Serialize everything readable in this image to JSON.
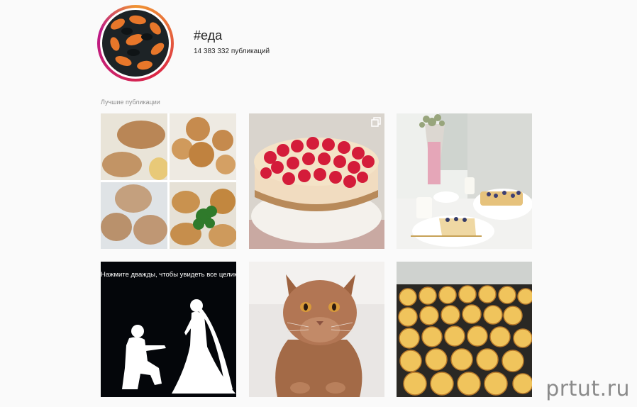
{
  "header": {
    "hashtag": "#еда",
    "post_count": "14 383 332 публикаций",
    "avatar_icon": "food-collage-avatar"
  },
  "top_posts": {
    "section_label": "Лучшие публикации",
    "tiles": [
      {
        "name": "cutlets-collage",
        "kind": "photo"
      },
      {
        "name": "raspberry-cheesecake",
        "kind": "photo",
        "badge_icon": "multi-photo-icon"
      },
      {
        "name": "breakfast-table",
        "kind": "photo"
      },
      {
        "name": "proposal-silhouette",
        "kind": "photo",
        "caption": "Нажмите дважды, чтобы увидеть все целиком"
      },
      {
        "name": "british-kitten",
        "kind": "photo"
      },
      {
        "name": "syrniki-tray",
        "kind": "photo"
      }
    ]
  },
  "watermark": "prtut.ru",
  "colors": {
    "background": "#fafafa",
    "ring_start": "#f09433",
    "ring_end": "#bc1888",
    "muted_text": "#8e8e8e"
  }
}
